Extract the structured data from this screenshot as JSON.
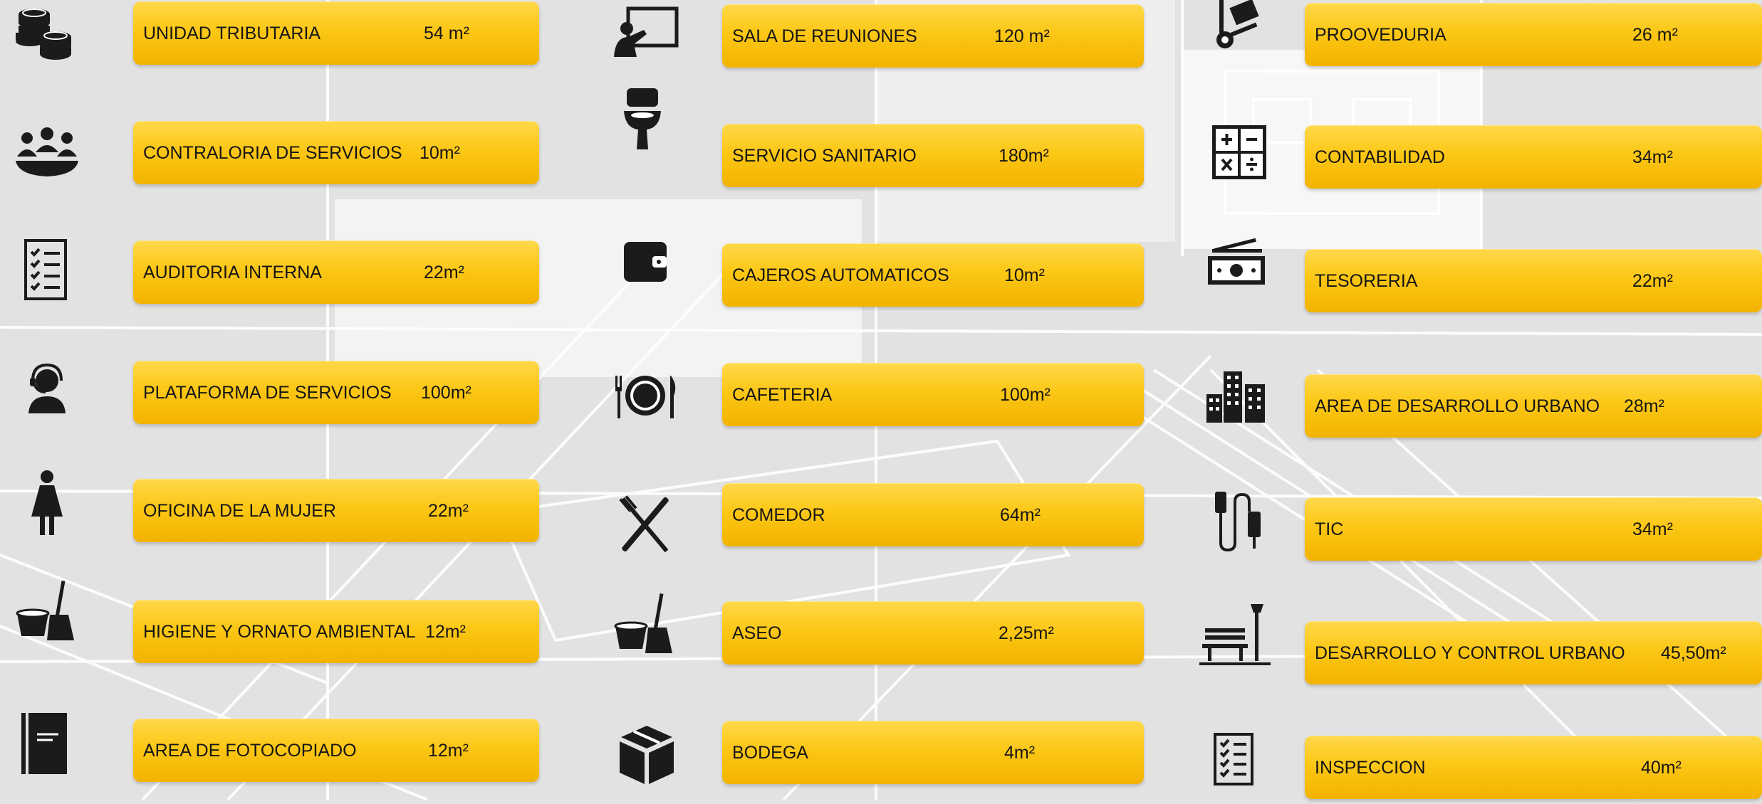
{
  "columns": [
    {
      "items": [
        {
          "label": "UNIDAD TRIBUTARIA",
          "area": "54 m²",
          "icon": "coins-stack-icon"
        },
        {
          "label": "CONTRALORIA DE SERVICIOS",
          "area": "10m²",
          "icon": "group-meeting-icon"
        },
        {
          "label": "AUDITORIA INTERNA",
          "area": "22m²",
          "icon": "checklist-icon"
        },
        {
          "label": "PLATAFORMA DE SERVICIOS",
          "area": "100m²",
          "icon": "headset-agent-icon"
        },
        {
          "label": "OFICINA DE LA MUJER",
          "area": "22m²",
          "icon": "woman-icon"
        },
        {
          "label": "HIGIENE Y ORNATO AMBIENTAL",
          "area": "12m²",
          "icon": "bucket-broom-icon"
        },
        {
          "label": "AREA DE FOTOCOPIADO",
          "area": "12m²",
          "icon": "document-book-icon"
        }
      ]
    },
    {
      "items": [
        {
          "label": "SALA DE REUNIONES",
          "area": "120 m²",
          "icon": "presentation-board-icon"
        },
        {
          "label": "SERVICIO SANITARIO",
          "area": "180m²",
          "icon": "toilet-icon"
        },
        {
          "label": "CAJEROS AUTOMATICOS",
          "area": "10m²",
          "icon": "wallet-icon"
        },
        {
          "label": "CAFETERIA",
          "area": "100m²",
          "icon": "plate-cutlery-icon"
        },
        {
          "label": "COMEDOR",
          "area": "64m²",
          "icon": "fork-knife-icon"
        },
        {
          "label": "ASEO",
          "area": "2,25m²",
          "icon": "bucket-broom-icon"
        },
        {
          "label": "BODEGA",
          "area": "4m²",
          "icon": "box-icon"
        }
      ]
    },
    {
      "items": [
        {
          "label": "PROOVEDURIA",
          "area": "26 m²",
          "icon": "hand-truck-icon"
        },
        {
          "label": "CONTABILIDAD",
          "area": "34m²",
          "icon": "calculator-icon"
        },
        {
          "label": "TESORERIA",
          "area": "22m²",
          "icon": "banknotes-icon"
        },
        {
          "label": "AREA DE DESARROLLO URBANO",
          "area": "28m²",
          "icon": "city-buildings-icon"
        },
        {
          "label": "TIC",
          "area": "34m²",
          "icon": "usb-cable-icon"
        },
        {
          "label": "DESARROLLO Y CONTROL URBANO",
          "area": "45,50m²",
          "icon": "park-bench-icon"
        },
        {
          "label": "INSPECCION",
          "area": "40m²",
          "icon": "checklist-icon"
        }
      ]
    }
  ]
}
